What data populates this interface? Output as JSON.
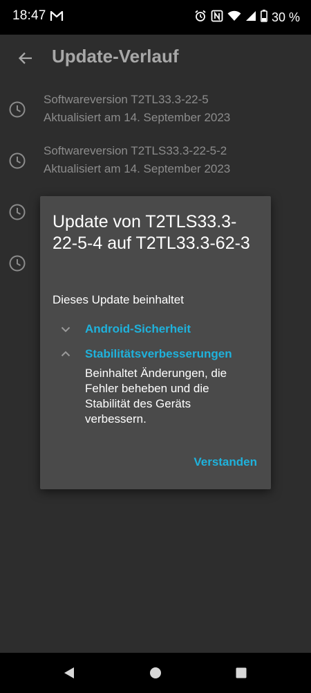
{
  "status_bar": {
    "time": "18:47",
    "battery_text": "30 %",
    "icons": [
      "gmail-icon",
      "alarm-icon",
      "nfc-icon",
      "wifi-icon",
      "signal-icon",
      "battery-icon"
    ]
  },
  "app_bar": {
    "title": "Update-Verlauf",
    "back_icon": "arrow-left-icon"
  },
  "history": {
    "items": [
      {
        "title": "Softwareversion T2TL33.3-22-5",
        "subtitle": "Aktualisiert am 14. September 2023",
        "icon": "clock-icon"
      },
      {
        "title": "Softwareversion T2TLS33.3-22-5-2",
        "subtitle": "Aktualisiert am 14. September 2023",
        "icon": "clock-icon"
      },
      {
        "title": "",
        "subtitle": "",
        "icon": "clock-icon"
      },
      {
        "title": "",
        "subtitle": "",
        "icon": "clock-icon"
      }
    ]
  },
  "dialog": {
    "title": "Update von T2TLS33.3-22-5-4 auf T2TL33.3-62-3",
    "subheading": "Dieses Update beinhaltet",
    "sections": [
      {
        "label": "Android-Sicherheit",
        "expanded": false
      },
      {
        "label": "Stabilitätsverbesserungen",
        "expanded": true
      }
    ],
    "expanded_body": "Beinhaltet Änderungen, die Fehler beheben und die Stabilität des Geräts verbessern.",
    "confirm_label": "Verstanden"
  },
  "nav_bar": {
    "buttons": [
      "back-icon",
      "home-icon",
      "recents-icon"
    ]
  },
  "colors": {
    "accent": "#1fb2dc",
    "dialog_bg": "#4a4a4a",
    "screen_bg": "#2d2d2d"
  }
}
